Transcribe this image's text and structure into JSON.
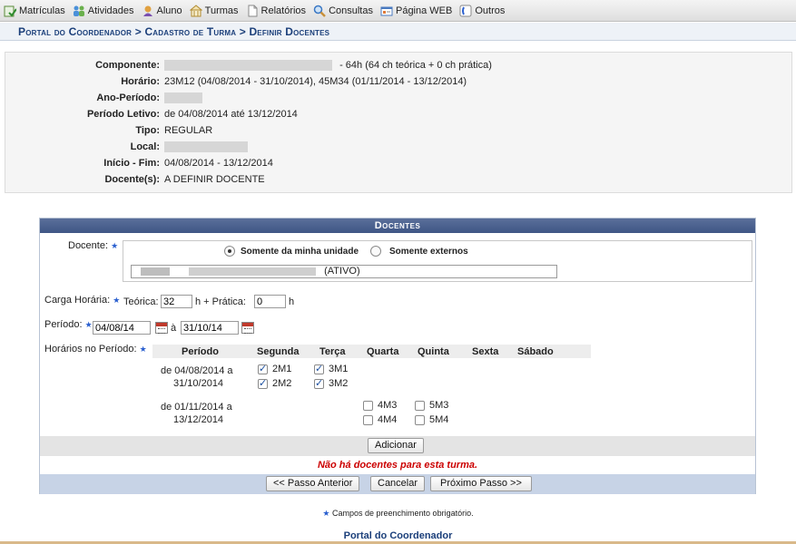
{
  "menu": [
    {
      "label": "Matrículas",
      "icon": "enrollment-icon"
    },
    {
      "label": "Atividades",
      "icon": "activities-icon"
    },
    {
      "label": "Aluno",
      "icon": "student-icon"
    },
    {
      "label": "Turmas",
      "icon": "classes-icon"
    },
    {
      "label": "Relatórios",
      "icon": "reports-icon"
    },
    {
      "label": "Consultas",
      "icon": "search-icon"
    },
    {
      "label": "Página WEB",
      "icon": "webpage-icon"
    },
    {
      "label": "Outros",
      "icon": "others-icon"
    }
  ],
  "breadcrumb": "Portal do Coordenador > Cadastro de Turma > Definir Docentes",
  "info": {
    "componente": {
      "label": "Componente:",
      "value_suffix": "- 64h (64 ch teórica + 0 ch prática)"
    },
    "horario": {
      "label": "Horário:",
      "value": "23M12 (04/08/2014 - 31/10/2014), 45M34 (01/11/2014 - 13/12/2014)"
    },
    "ano_periodo": {
      "label": "Ano-Período:"
    },
    "periodo_letivo": {
      "label": "Período Letivo:",
      "value": "de 04/08/2014 até 13/12/2014"
    },
    "tipo": {
      "label": "Tipo:",
      "value": "REGULAR"
    },
    "local": {
      "label": "Local:"
    },
    "inicio_fim": {
      "label": "Início - Fim:",
      "value": "04/08/2014 - 13/12/2014"
    },
    "docentes": {
      "label": "Docente(s):",
      "value": "A DEFINIR DOCENTE"
    }
  },
  "form": {
    "title": "Docentes",
    "docente_label": "Docente:",
    "radio_own_unit": "Somente da minha unidade",
    "radio_external": "Somente externos",
    "docente_value_suffix": "(ATIVO)",
    "carga_label": "Carga Horária:",
    "teorica_label": "Teórica:",
    "teorica_value": "32",
    "h_plus_pratica": "h + Prática:",
    "pratica_value": "0",
    "h_suffix": "h",
    "periodo_label": "Período:",
    "periodo_start": "04/08/14",
    "periodo_sep": "à",
    "periodo_end": "31/10/14",
    "horarios_label": "Horários no Período:",
    "columns": [
      "Período",
      "Segunda",
      "Terça",
      "Quarta",
      "Quinta",
      "Sexta",
      "Sábado"
    ],
    "row1_period_line1": "de 04/08/2014 a",
    "row1_period_line2": "31/10/2014",
    "row2_period_line1": "de 01/11/2014 a",
    "row2_period_line2": "13/12/2014",
    "slots": {
      "seg1": "2M1",
      "seg2": "2M2",
      "ter1": "3M1",
      "ter2": "3M2",
      "qua1": "4M3",
      "qua2": "4M4",
      "qui1": "5M3",
      "qui2": "5M4"
    },
    "add_button": "Adicionar",
    "no_docentes_msg": "Não há docentes para esta turma.",
    "prev_button": "<< Passo Anterior",
    "cancel_button": "Cancelar",
    "next_button": "Próximo Passo >>"
  },
  "footer": {
    "required_note": "Campos de preenchimento obrigatório.",
    "portal_link": "Portal do Coordenador"
  },
  "colors": {
    "header_blue": "#3f5685",
    "link_blue": "#1b3f7a",
    "error_red": "#cc0000",
    "band_gray": "#e4e4e4",
    "band_blue": "#c7d3e6"
  }
}
